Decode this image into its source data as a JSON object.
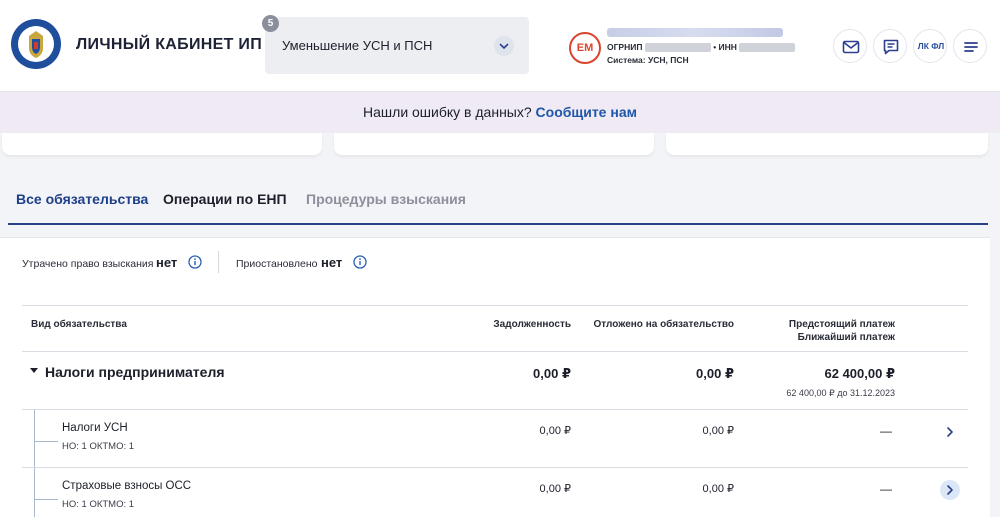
{
  "header": {
    "app_title": "ЛИЧНЫЙ КАБИНЕТ ИП",
    "mode_badge": "5",
    "mode_selected": "Уменьшение УСН и ПСН",
    "user_initials": "ЕМ",
    "ogrnip_label": "ОГРНИП",
    "inn_label": "• ИНН",
    "system_label": "Система: УСН, ПСН",
    "lkfl_label": "ЛК ФЛ",
    "icons": [
      "mail-icon",
      "chat-icon",
      "menu-icon"
    ]
  },
  "notice": {
    "text": "Нашли ошибку в данных?",
    "link": "Сообщите нам"
  },
  "tabs": [
    {
      "label": "Все обязательства",
      "state": "active"
    },
    {
      "label": "Операции по ЕНП",
      "state": "normal"
    },
    {
      "label": "Процедуры взыскания",
      "state": "muted"
    }
  ],
  "status": {
    "lost_right_label": "Утрачено право взыскания",
    "lost_right_value": "нет",
    "suspended_label": "Приостановлено",
    "suspended_value": "нет"
  },
  "table": {
    "headers": {
      "type": "Вид обязательства",
      "debt": "Задолженность",
      "deferred": "Отложено на обязательство",
      "upcoming": "Предстоящий платеж",
      "nearest": "Ближайший платеж"
    },
    "group": {
      "name": "Налоги предпринимателя",
      "debt": "0,00 ₽",
      "deferred": "0,00 ₽",
      "upcoming": "62 400,00 ₽",
      "nearest": "62 400,00 ₽ до 31.12.2023"
    },
    "rows": [
      {
        "name": "Налоги УСН",
        "meta": "НО: 1 ОКТМО: 1",
        "debt": "0,00 ₽",
        "deferred": "0,00 ₽",
        "upcoming": "—"
      },
      {
        "name": "Страховые взносы ОСС",
        "meta": "НО: 1 ОКТМО: 1",
        "debt": "0,00 ₽",
        "deferred": "0,00 ₽",
        "upcoming": "—"
      }
    ]
  },
  "colors": {
    "accent": "#1d3f8a",
    "link": "#1f56a8",
    "avatar": "#d9452d",
    "notice_bg": "#efeaf3"
  }
}
